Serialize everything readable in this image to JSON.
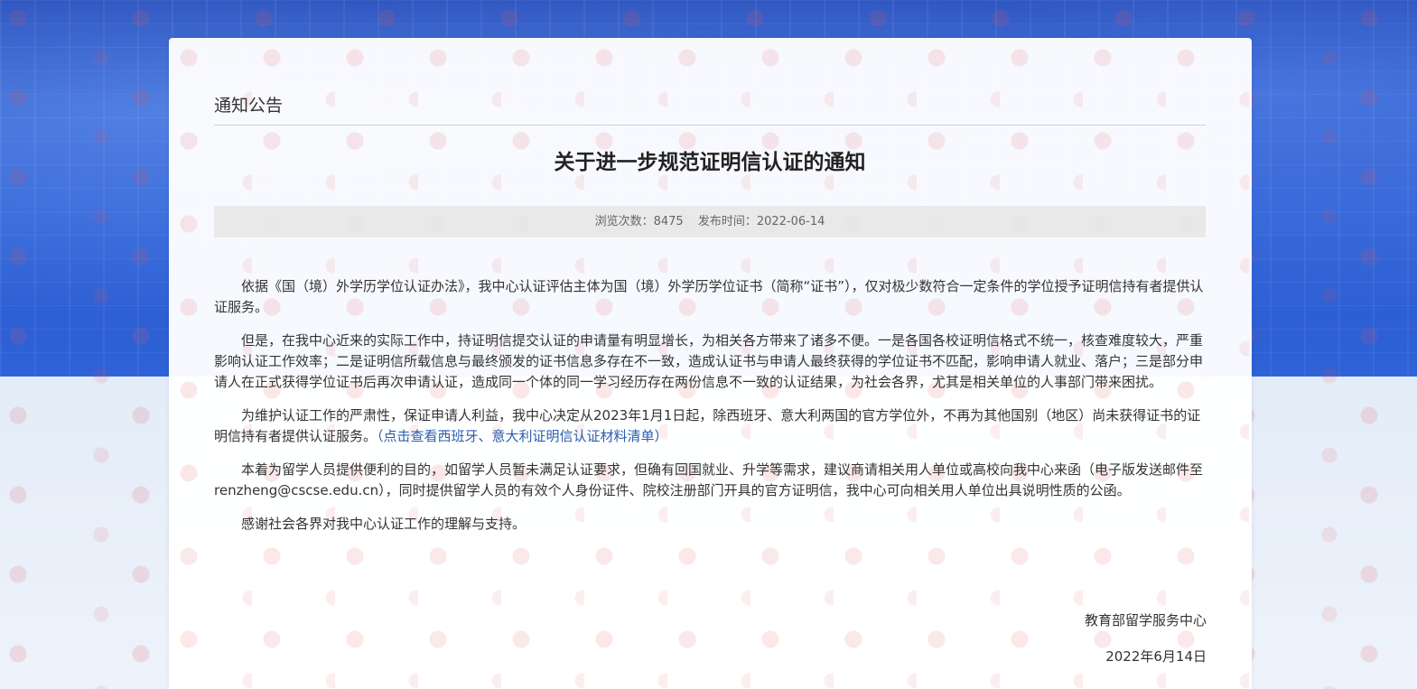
{
  "section_heading": "通知公告",
  "article": {
    "title": "关于进一步规范证明信认证的通知",
    "views_label": "浏览次数：",
    "views": "8475",
    "date_label": "发布时间：",
    "date": "2022-06-14",
    "paragraphs": [
      "依据《国（境）外学历学位认证办法》，我中心认证评估主体为国（境）外学历学位证书（简称“证书”），仅对极少数符合一定条件的学位授予证明信持有者提供认证服务。",
      "但是，在我中心近来的实际工作中，持证明信提交认证的申请量有明显增长，为相关各方带来了诸多不便。一是各国各校证明信格式不统一，核查难度较大，严重影响认证工作效率；二是证明信所载信息与最终颁发的证书信息多存在不一致，造成认证书与申请人最终获得的学位证书不匹配，影响申请人就业、落户；三是部分申请人在正式获得学位证书后再次申请认证，造成同一个体的同一学习经历存在两份信息不一致的认证结果，为社会各界，尤其是相关单位的人事部门带来困扰。",
      "为维护认证工作的严肃性，保证申请人利益，我中心决定从2023年1月1日起，除西班牙、意大利两国的官方学位外，不再为其他国别（地区）尚未获得证书的证明信持有者提供认证服务。",
      "本着为留学人员提供便利的目的，如留学人员暂未满足认证要求，但确有回国就业、升学等需求，建议商请相关用人单位或高校向我中心来函（电子版发送邮件至renzheng@cscse.edu.cn），同时提供留学人员的有效个人身份证件、院校注册部门开具的官方证明信，我中心可向相关用人单位出具说明性质的公函。",
      "感谢社会各界对我中心认证工作的理解与支持。"
    ],
    "link_text": "（点击查看西班牙、意大利证明信认证材料清单）",
    "signature_org": "教育部留学服务中心",
    "signature_date": "2022年6月14日"
  }
}
